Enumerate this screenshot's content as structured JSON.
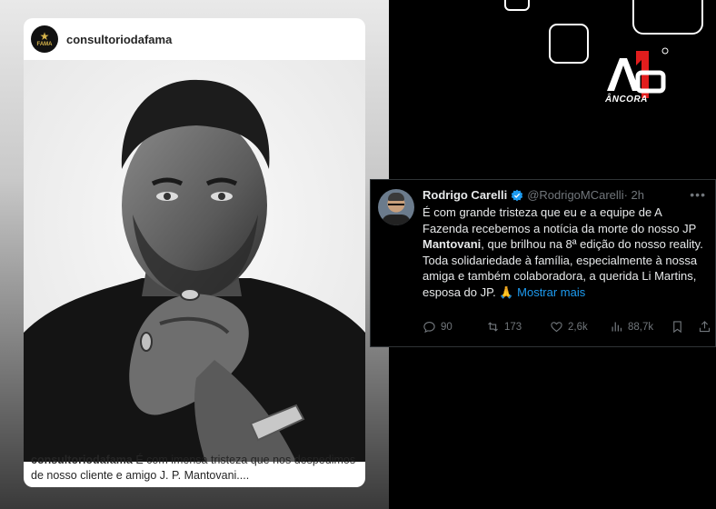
{
  "instagram": {
    "username": "consultoriodafama",
    "avatar_text": "FAMA",
    "caption_user": "consultoriodafama",
    "caption_text": "É com imensa tristeza que nos despedimos de nosso cliente e amigo J. P. Mantovani...."
  },
  "brand": {
    "logo_label": "ÂNCORA",
    "accent": "#e11d1d"
  },
  "tweet": {
    "name": "Rodrigo Carelli",
    "handle": "@RodrigoMCarelli",
    "time": "· 2h",
    "text_part1": "É com grande tristeza que eu e a equipe de A Fazenda recebemos a notícia da morte do nosso JP ",
    "text_bold": "Mantovani",
    "text_part2": ", que brilhou na 8ª edição do nosso reality.",
    "text_part3": "Toda solidariedade à família, especialmente à nossa amiga e também colaboradora, a querida Li Martins, esposa do JP. 🙏",
    "show_more": "Mostrar mais",
    "replies": "90",
    "retweets": "173",
    "likes": "2,6k",
    "views": "88,7k",
    "verified_color": "#1d9bf0"
  }
}
